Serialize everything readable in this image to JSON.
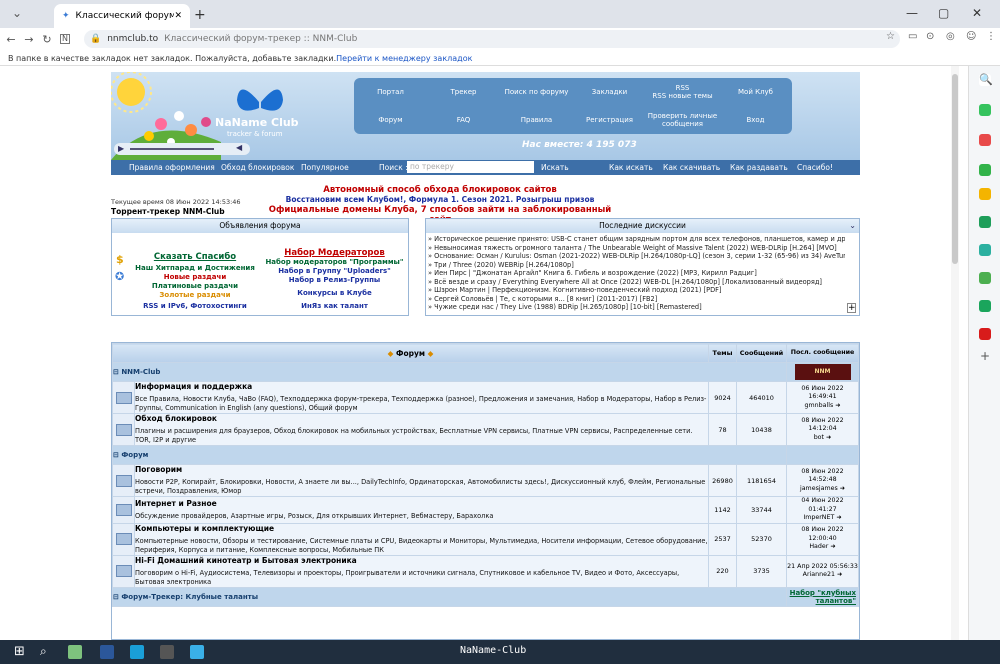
{
  "browser": {
    "tab_title": "Классический форум-трекер",
    "url": "nnmclub.to",
    "page_title": "Классический форум-трекер :: NNM-Club",
    "bookmarks_msg": "В папке в качестве закладок нет закладок. Пожалуйста, добавьте закладки.",
    "bookmarks_link": "Перейти к менеджеру закладок"
  },
  "header": {
    "logo_text": "NaName Club",
    "logo_sub": "tracker & forum",
    "online": "Нас вместе: 4 195 073",
    "nav": [
      "Портал",
      "Трекер",
      "Поиск по форуму",
      "Закладки",
      "RSS\nRSS новые темы",
      "Мой Клуб",
      "Форум",
      "FAQ",
      "Правила",
      "Регистрация",
      "Проверить личные сообщения",
      "Вход"
    ],
    "bar": {
      "rules": "Правила оформления",
      "bypass": "Обход блокировок",
      "popular": "Популярное",
      "search_label": "Поиск :",
      "search_placeholder": "по трекеру",
      "search_btn": "Искать",
      "how_search": "Как искать",
      "how_download": "Как скачивать",
      "how_seed": "Как раздавать",
      "thanks": "Спасибо!"
    }
  },
  "announce": {
    "line1": "Автономный способ обхода блокировок сайтов",
    "line2": "Восстановим всем Клубом!, Формула 1. Сезон 2021. Розыгрыш призов",
    "line3": "Официальные домены Клуба, 7 способов зайти на заблокированный сайт"
  },
  "time": "Текущее время 08 Июн 2022 14:53:46",
  "tracker_title": "Торрент-трекер NNM-Club",
  "ann_box": {
    "title": "Объявления форума",
    "left": [
      "Сказать Спасибо",
      "Наш Хитпарад и Достижения",
      "Новые раздачи",
      "Платиновые раздачи",
      "Золотые раздачи",
      "RSS и IPv6, Фотохостинги"
    ],
    "right": [
      "Набор Модераторов",
      "Набор модераторов \"Программы\"",
      "Набор в Группу \"Uploaders\"",
      "Набор в Релиз-Группы",
      "Конкурсы в Клубе",
      "ИнЯз как талант"
    ]
  },
  "disc_box": {
    "title": "Последние дискуссии",
    "items": [
      "Историческое решение принято: USB-C станет общим зарядным портом для всех телефонов, планшетов, камер и других гаджетов в ЕС",
      "Невыносимая тяжесть огромного таланта / The Unbearable Weight of Massive Talent (2022) WEB-DLRip [H.264] [MVO]",
      "Основание: Осман / Kurulus: Osman (2021-2022) WEB-DLRip [H.264/1080p-LQ] (сезон 3, серии 1-32 (65-96) из 34) AveTurk (обновляемая)",
      "Три / Three (2020) WEBRip [H.264/1080p]",
      "Йен Пирс | \"Джонатан Аргайл\" Книга 6. Гибель и возрождение (2022) [MP3, Кирилл Радциг]",
      "Всё везде и сразу / Everything Everywhere All at Once (2022) WEB-DL [H.264/1080p] [Локализованный видеоряд]",
      "Шзрон Мартин | Перфекционизм. Когнитивно-поведенческий подход (2021) [PDF]",
      "Сергей Соловьёв | Те, с которыми я... [8 книг] (2011-2017) [FB2]",
      "Чужие среди нас / They Live (1988) BDRip [H.265/1080p] [10-bit] [Remastered]"
    ]
  },
  "forum": {
    "cols": [
      "Форум",
      "Темы",
      "Сообщений",
      "Посл. сообщение"
    ],
    "cats": [
      {
        "name": "NNM-Club",
        "rows": [
          {
            "title": "Информация и поддержка",
            "subs": "Все Правила, Новости Клуба, ЧаВо (FAQ), Техподдержка форум-трекера, Техподдержка (разное), Предложения и замечания, Набор в Модераторы, Набор в Релиз-Группы, Communication in English (any questions), Общий форум",
            "topics": "9024",
            "posts": "464010",
            "date": "06 Июн 2022 16:49:41",
            "user": "gmnballs"
          },
          {
            "title": "Обход блокировок",
            "subs": "Плагины и расширения для браузеров, Обход блокировок на мобильных устройствах, Бесплатные VPN сервисы, Платные VPN сервисы, Распределенные сети. TOR, I2P и другие",
            "topics": "78",
            "posts": "10438",
            "date": "08 Июн 2022 14:12:04",
            "user": "bot"
          }
        ]
      },
      {
        "name": "Форум",
        "rows": [
          {
            "title": "Поговорим",
            "subs": "Новости P2P, Копирайт, Блокировки, Новости, А знаете ли вы..., DailyTechInfo, Ординаторская, Автомобилисты здесь!, Дискуссионный клуб, Флейм, Региональные встречи, Поздравления, Юмор",
            "topics": "26980",
            "posts": "1181654",
            "date": "08 Июн 2022 14:52:48",
            "user": "jamesjames"
          },
          {
            "title": "Интернет и Разное",
            "subs": "Обсуждение провайдеров, Азартные игры, Розыск, Для открывших Интернет, Вебмастеру, Барахолка",
            "topics": "1142",
            "posts": "33744",
            "date": "04 Июн 2022 01:41:27",
            "user": "ImperNET"
          },
          {
            "title": "Компьютеры и комплектующие",
            "subs": "Компьютерные новости, Обзоры и тестирование, Системные платы и CPU, Видеокарты и Мониторы, Мультимедиа, Носители информации, Сетевое оборудование, Периферия, Корпуса и питание, Комплексные вопросы, Мобильные ПК",
            "topics": "2537",
            "posts": "52370",
            "date": "08 Июн 2022 12:00:40",
            "user": "Hader"
          },
          {
            "title": "Hi-Fi Домашний кинотеатр и Бытовая электроника",
            "subs": "Поговорим о Hi-Fi, Аудиосистема, Телевизоры и проекторы, Проигрыватели и источники сигнала, Спутниковое и кабельное TV, Видео и Фото, Аксессуары, Бытовая электроника",
            "topics": "220",
            "posts": "3735",
            "date": "21 Апр 2022 05:56:33",
            "user": "Arianne21"
          }
        ]
      },
      {
        "name": "Форум-Трекер: Клубные таланты",
        "link": "Набор \"клубных талантов\"",
        "rows": []
      }
    ]
  },
  "taskbar": {
    "title": "NaName-Club"
  },
  "colors": {
    "accent": "#3d6fa8",
    "red": "#c00000",
    "green": "#006633"
  }
}
